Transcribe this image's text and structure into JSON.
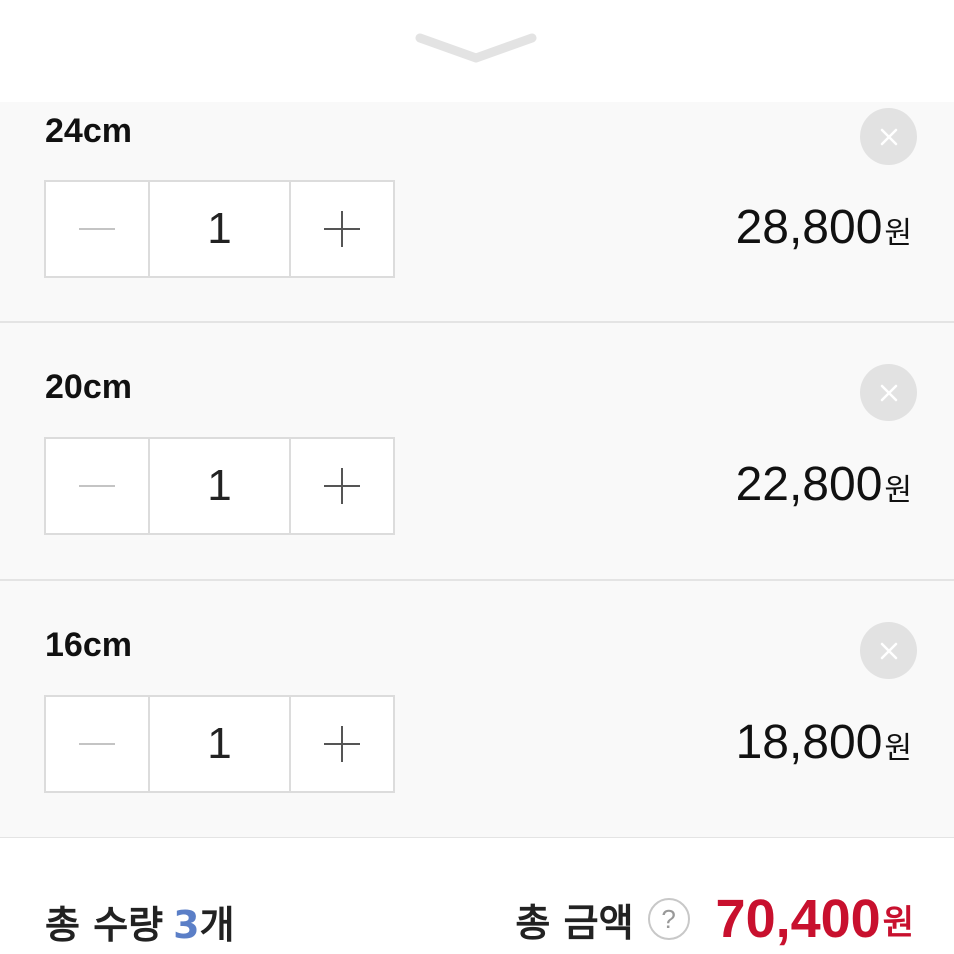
{
  "sheet": {
    "handle_icon": "chevron-down-icon"
  },
  "options": [
    {
      "name": "24cm",
      "quantity": "1",
      "price": "28,800",
      "currency": "원"
    },
    {
      "name": "20cm",
      "quantity": "1",
      "price": "22,800",
      "currency": "원"
    },
    {
      "name": "16cm",
      "quantity": "1",
      "price": "18,800",
      "currency": "원"
    }
  ],
  "stepper": {
    "minus_symbol": "−",
    "plus_symbol": "+"
  },
  "summary": {
    "qty_label": "총 수량",
    "qty_value": "3",
    "qty_unit": "개",
    "amount_label": "총 금액",
    "help_symbol": "?",
    "total": "70,400",
    "currency": "원"
  },
  "colors": {
    "accent_red": "#c8102e",
    "count_blue": "#5b7fc7",
    "panel_bg": "#f9f9f9"
  }
}
